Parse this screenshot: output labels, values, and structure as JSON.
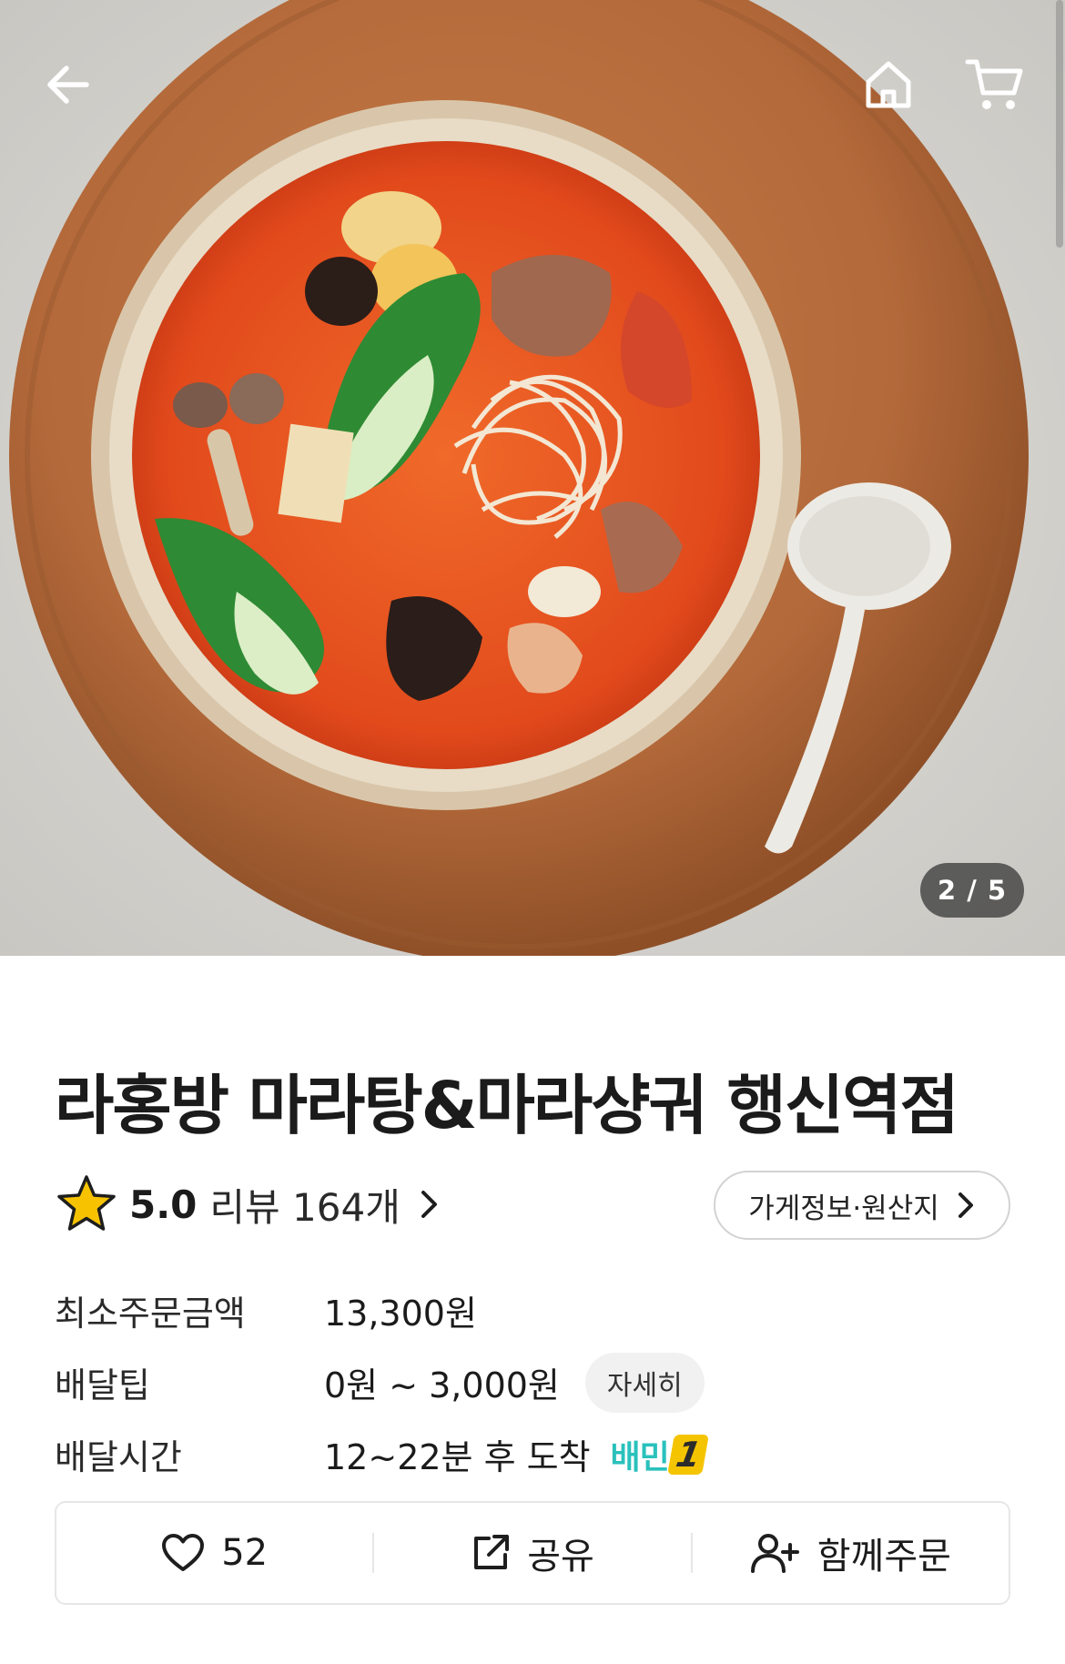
{
  "hero": {
    "pager": "2 / 5",
    "icons": {
      "back": "arrow-left-icon",
      "home": "home-icon",
      "cart": "cart-icon"
    }
  },
  "store": {
    "name": "라홍방 마라탕&마라샹궈 행신역점",
    "rating": "5.0",
    "review_text": "리뷰 164개",
    "info_button": "가게정보·원산지"
  },
  "details": {
    "min_order_label": "최소주문금액",
    "min_order_value": "13,300원",
    "delivery_tip_label": "배달팁",
    "delivery_tip_value": "0원 ~ 3,000원",
    "detail_chip": "자세히",
    "delivery_time_label": "배달시간",
    "delivery_time_value": "12~22분 후 도착",
    "badge_text": "배민",
    "badge_number": "1"
  },
  "actions": {
    "like_count": "52",
    "share_label": "공유",
    "group_order_label": "함께주문"
  },
  "colors": {
    "accent": "#2ac1bc",
    "star": "#f7c300",
    "board": "#b3693a"
  }
}
